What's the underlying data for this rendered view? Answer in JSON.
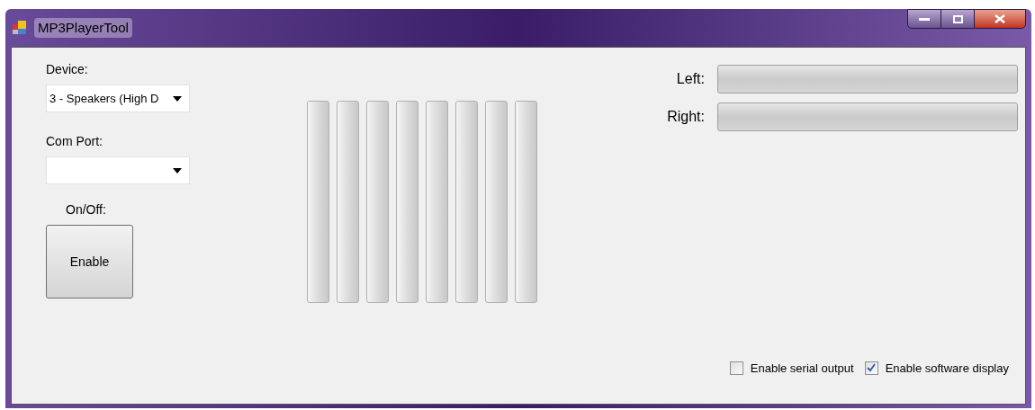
{
  "window": {
    "title": "MP3PlayerTool"
  },
  "device": {
    "label": "Device:",
    "value": "3 - Speakers (High D"
  },
  "com_port": {
    "label": "Com Port:"
  },
  "power": {
    "label": "On/Off:",
    "button": "Enable"
  },
  "spectrum": [
    {
      "level": 0
    },
    {
      "level": 0
    },
    {
      "level": 0
    },
    {
      "level": 0
    },
    {
      "level": 0
    },
    {
      "level": 0
    },
    {
      "level": 0
    },
    {
      "level": 0
    }
  ],
  "channels": [
    {
      "label": "Left:",
      "level": 0
    },
    {
      "label": "Right:",
      "level": 0
    }
  ],
  "options": [
    {
      "label": "Enable serial output",
      "checked": false
    },
    {
      "label": "Enable software display",
      "checked": true
    }
  ]
}
